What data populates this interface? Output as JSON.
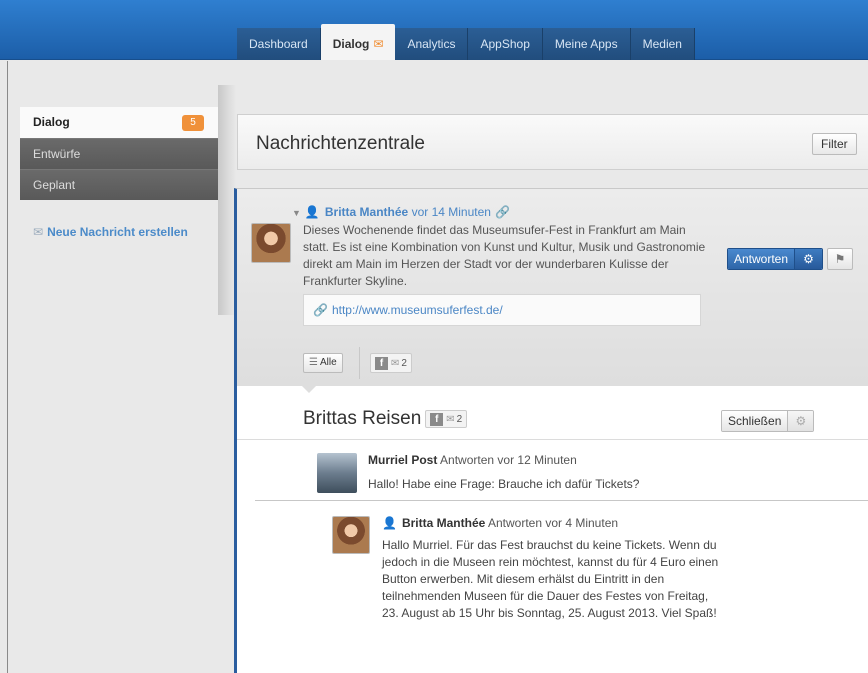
{
  "nav": {
    "tabs": [
      {
        "label": "Dashboard"
      },
      {
        "label": "Dialog"
      },
      {
        "label": "Analytics"
      },
      {
        "label": "AppShop"
      },
      {
        "label": "Meine Apps"
      },
      {
        "label": "Medien"
      }
    ],
    "active_tab": "Dialog"
  },
  "sidebar": {
    "items": [
      {
        "label": "Dialog",
        "badge": "5"
      },
      {
        "label": "Entwürfe"
      },
      {
        "label": "Geplant"
      }
    ],
    "new_message": "Neue Nachricht erstellen"
  },
  "header": {
    "title": "Nachrichtenzentrale",
    "filter_label": "Filter"
  },
  "message": {
    "author": "Britta Manthée",
    "time": "vor 14 Minuten",
    "text": "Dieses Wochenende findet das Museumsufer-Fest in Frankfurt am Main statt. Es ist eine Kombination von Kunst und Kultur, Musik und Gastronomie direkt am Main im Herzen der Stadt vor der wunderbaren Kulisse der Frankfurter Skyline.",
    "link": "http://www.museumsuferfest.de/",
    "reply_label": "Antworten",
    "all_label": "Alle",
    "channel_count": "2"
  },
  "thread": {
    "title": "Brittas Reisen",
    "channel_count": "2",
    "close_label": "Schließen",
    "replies": [
      {
        "author": "Murriel Post",
        "meta": "Antworten vor 12 Minuten",
        "text": "Hallo! Habe eine Frage: Brauche ich dafür Tickets?"
      },
      {
        "author": "Britta Manthée",
        "meta": "Antworten vor 4 Minuten",
        "text": "Hallo Murriel. Für das Fest brauchst du keine Tickets. Wenn du jedoch in die Museen rein möchtest, kannst du für 4 Euro einen Button erwerben. Mit diesem erhälst du Eintritt in den teilnehmenden Museen für die Dauer des Festes von Freitag, 23. August ab 15 Uhr bis Sonntag, 25. August 2013. Viel Spaß!"
      }
    ]
  },
  "colors": {
    "brand_blue": "#1c5ea8",
    "accent_orange": "#f0913a",
    "panel_border": "#2a5d9f"
  }
}
